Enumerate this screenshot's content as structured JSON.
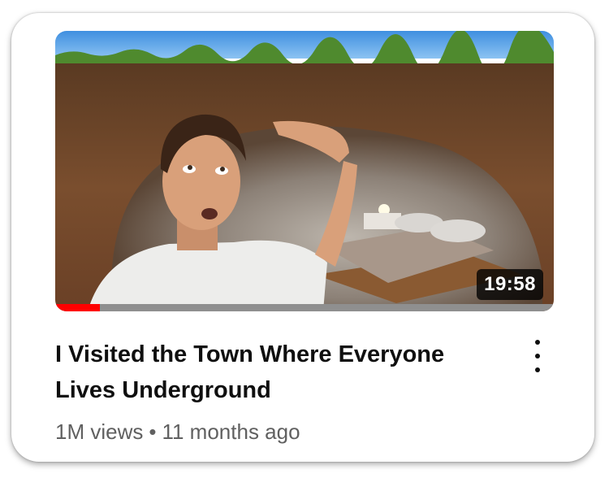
{
  "video": {
    "title": "I Visited the Town Where Everyone Lives Underground",
    "duration": "19:58",
    "views": "1M views",
    "separator": "•",
    "age": "11 months ago",
    "watch_progress": 0.09
  },
  "colors": {
    "progress": "#ff0000",
    "track": "#8f8f8f",
    "title": "#0f0f0f",
    "meta": "#606060"
  },
  "icons": {
    "more_actions": "vertical-ellipsis-icon"
  }
}
